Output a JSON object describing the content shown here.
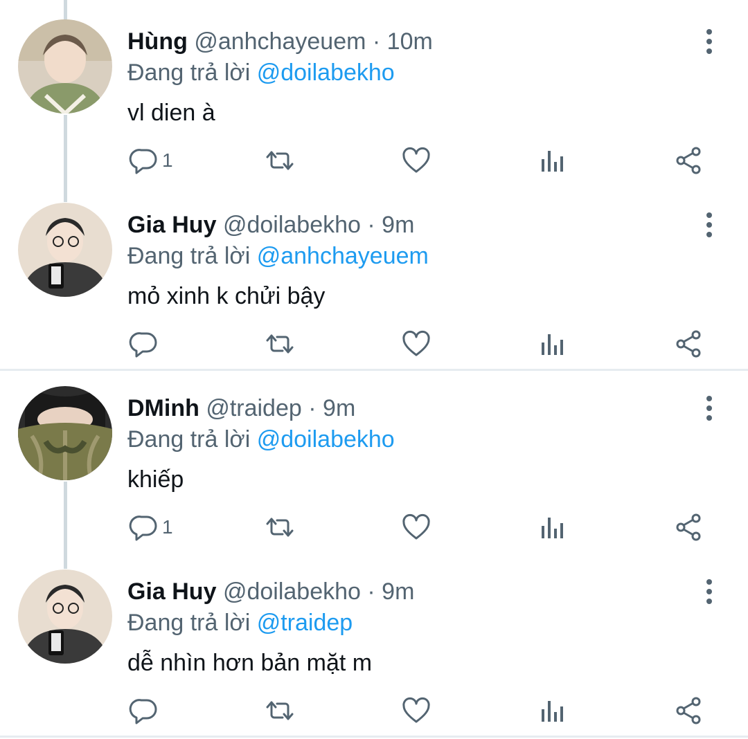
{
  "replying_prefix": "Đang trả lời",
  "colors": {
    "link": "#1d9bf0",
    "muted": "#536471",
    "text": "#0f1419",
    "thread_line": "#cfd9de"
  },
  "icons": {
    "reply": "reply-icon",
    "retweet": "retweet-icon",
    "like": "heart-icon",
    "views": "views-icon",
    "share": "share-icon",
    "more": "more-vertical-icon"
  },
  "tweets": [
    {
      "name": "Hùng",
      "handle": "@anhchayeuem",
      "sep": "·",
      "time": "10m",
      "reply_to": "@doilabekho",
      "text": "vl dien à",
      "reply_count": "1"
    },
    {
      "name": "Gia Huy",
      "handle": "@doilabekho",
      "sep": "·",
      "time": "9m",
      "reply_to": "@anhchayeuem",
      "text": "mỏ xinh k chửi bậy",
      "reply_count": ""
    },
    {
      "name": "DMinh",
      "handle": "@traidep",
      "sep": "·",
      "time": "9m",
      "reply_to": "@doilabekho",
      "text": "khiếp",
      "reply_count": "1"
    },
    {
      "name": "Gia Huy",
      "handle": "@doilabekho",
      "sep": "·",
      "time": "9m",
      "reply_to": "@traidep",
      "text": "dễ nhìn hơn bản mặt m",
      "reply_count": ""
    }
  ]
}
